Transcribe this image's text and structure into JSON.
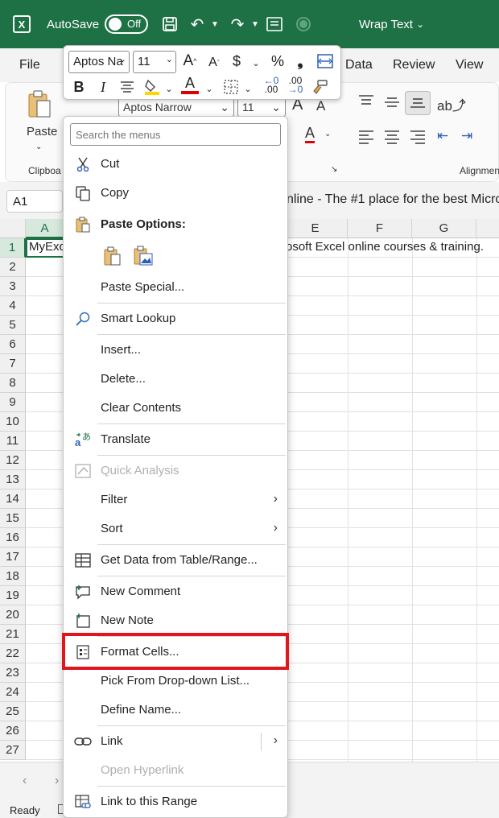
{
  "titlebar": {
    "autosave_label": "AutoSave",
    "toggle_text": "Off",
    "wrap_text_label": "Wrap Text"
  },
  "ribbon": {
    "tabs": [
      "File",
      "Data",
      "Review",
      "View"
    ],
    "paste_label": "Paste",
    "clipboard_group": "Clipboa",
    "alignment_group": "Alignmen",
    "font_name": "Aptos Narrow",
    "font_size": "11"
  },
  "formula_bar": {
    "name_box": "A1",
    "content": "nline - The #1 place for the best Micro"
  },
  "grid": {
    "columns": [
      "A",
      "E",
      "F",
      "G"
    ],
    "rows": [
      "1",
      "2",
      "3",
      "4",
      "5",
      "6",
      "7",
      "8",
      "9",
      "10",
      "11",
      "12",
      "13",
      "14",
      "15",
      "16",
      "17",
      "18",
      "19",
      "20",
      "21",
      "22",
      "23",
      "24",
      "25",
      "26",
      "27"
    ],
    "a1_text": "MyExc",
    "a1_overflow_text": "rosoft Excel online courses & training."
  },
  "status": {
    "ready": "Ready"
  },
  "mini_toolbar": {
    "font_name": "Aptos Na",
    "font_size": "11",
    "bold": "B",
    "italic": "I",
    "currency": "$",
    "percent": "%",
    "comma": "❟",
    "dec_inc": ".00",
    "dec_dec": ".00"
  },
  "context_menu": {
    "search_placeholder": "Search the menus",
    "items": [
      {
        "label": "Cut",
        "icon": "scissors-icon"
      },
      {
        "label": "Copy",
        "icon": "copy-icon"
      },
      {
        "label": "Paste Options:",
        "icon": "paste-icon"
      },
      {
        "label": "Paste Special...",
        "icon": ""
      },
      {
        "label": "Smart Lookup",
        "icon": "search-icon"
      },
      {
        "label": "Insert...",
        "icon": ""
      },
      {
        "label": "Delete...",
        "icon": ""
      },
      {
        "label": "Clear Contents",
        "icon": ""
      },
      {
        "label": "Translate",
        "icon": "translate-icon"
      },
      {
        "label": "Quick Analysis",
        "icon": "quick-analysis-icon"
      },
      {
        "label": "Filter",
        "icon": ""
      },
      {
        "label": "Sort",
        "icon": ""
      },
      {
        "label": "Get Data from Table/Range...",
        "icon": "table-icon"
      },
      {
        "label": "New Comment",
        "icon": "comment-icon"
      },
      {
        "label": "New Note",
        "icon": "note-icon"
      },
      {
        "label": "Format Cells...",
        "icon": "format-cells-icon"
      },
      {
        "label": "Pick From Drop-down List...",
        "icon": ""
      },
      {
        "label": "Define Name...",
        "icon": ""
      },
      {
        "label": "Link",
        "icon": "link-icon"
      },
      {
        "label": "Open Hyperlink",
        "icon": ""
      },
      {
        "label": "Link to this Range",
        "icon": "link-range-icon"
      }
    ]
  },
  "colors": {
    "excel_green": "#1e7145",
    "highlight_red": "#e0151e",
    "font_color_red": "#e00000",
    "fill_yellow": "#ffd700"
  }
}
